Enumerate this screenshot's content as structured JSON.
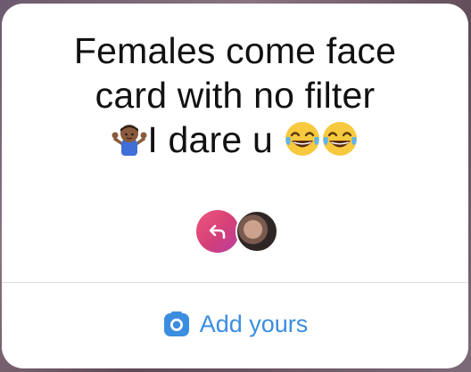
{
  "prompt": {
    "line1": "Females come face",
    "line2": "card with no filter",
    "line3_text": "I dare u",
    "emoji_before": "shrugging-person-emoji",
    "emoji_after": [
      "tears-of-joy-emoji",
      "tears-of-joy-emoji"
    ]
  },
  "responders": {
    "reply_icon": "reply-arrow-icon",
    "avatar": "user-avatar"
  },
  "action": {
    "label": "Add yours",
    "icon": "camera-icon",
    "accent_color": "#3b8de0"
  }
}
